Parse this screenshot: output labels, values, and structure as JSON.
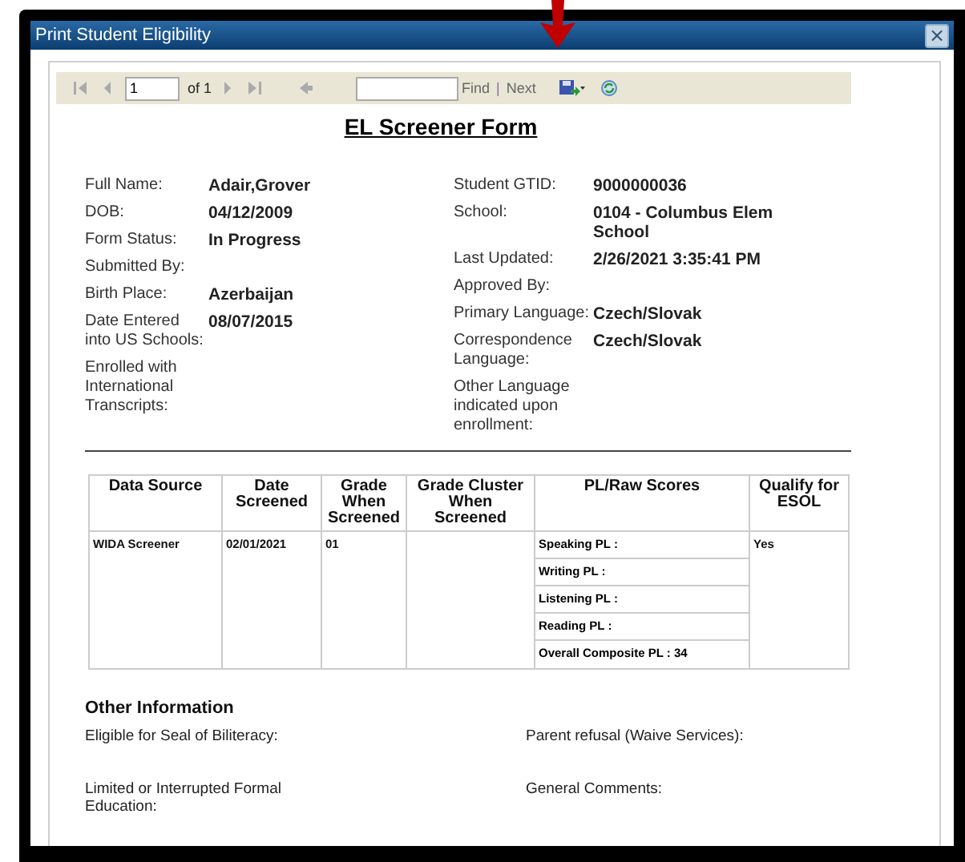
{
  "window": {
    "title": "Print Student Eligibility",
    "close": "×"
  },
  "toolbar": {
    "page": "1",
    "of": "of 1",
    "find": "Find",
    "separator": "|",
    "next": "Next"
  },
  "form_title": "EL Screener Form",
  "left_fields": [
    {
      "label": "Full Name:",
      "value": "Adair,Grover"
    },
    {
      "label": "DOB:",
      "value": "04/12/2009"
    },
    {
      "label": "Form Status:",
      "value": "In Progress"
    },
    {
      "label": "Submitted By:"
    },
    {
      "label": "Birth Place:",
      "value": "Azerbaijan"
    },
    {
      "label": "Date Entered into US Schools:",
      "value": "08/07/2015"
    },
    {
      "label": "Enrolled with International Transcripts:"
    }
  ],
  "right_fields": [
    {
      "label": "Student GTID:",
      "value": "9000000036"
    },
    {
      "label": "School:",
      "value": "0104 - Columbus Elem School"
    },
    {
      "label": "Last Updated:",
      "value": "2/26/2021 3:35:41 PM"
    },
    {
      "label": "Approved By:"
    },
    {
      "label": "Primary Language:",
      "value": "Czech/Slovak"
    },
    {
      "label": "Correspondence Language:",
      "value": "Czech/Slovak"
    },
    {
      "label": "Other Language indicated upon enrollment:"
    }
  ],
  "table": {
    "columns": [
      "Data Source",
      "Date Screened",
      "Grade When Screened",
      "Grade Cluster When Screened",
      "PL/Raw Scores",
      "Qualify for ESOL"
    ],
    "rows": [
      {
        "data_source": "WIDA Screener",
        "date_screened": "02/01/2021",
        "grade": "01",
        "scores": [
          "Speaking PL :",
          "Writing PL :",
          "Listening PL :",
          "Reading PL :",
          "Overall Composite PL : 34"
        ],
        "qualify": "Yes"
      }
    ]
  },
  "other_information": {
    "title": "Other Information",
    "left_fields": [
      "Eligible for Seal of Biliteracy:",
      "Limited or Interrupted Formal Education:"
    ],
    "right_fields": [
      "Parent refusal (Waive Services):",
      "General Comments:"
    ]
  }
}
